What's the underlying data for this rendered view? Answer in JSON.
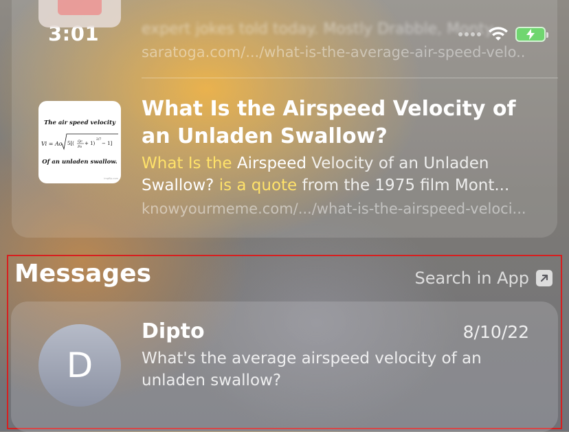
{
  "status_bar": {
    "time": "3:01",
    "battery_color": "#5dd15d"
  },
  "web_results": {
    "previous_result": {
      "snippet_blurred": "expert jokes told today. Mostly Drabble, Monty...",
      "url": "saratoga.com/.../what-is-the-average-air-speed-velo..."
    },
    "result": {
      "thumbnail_text": {
        "line1": "The air speed velocity",
        "formula_left": "Vi = Ao",
        "line3": "Of an unladen swallow.",
        "watermark": "imgflip.com"
      },
      "title": "What Is the Airspeed Velocity of an Unladen Swallow?",
      "snippet": {
        "p1": "What Is the ",
        "p2": "Airspeed",
        "p3": " Velocity of an Unladen ",
        "p4": "Swallow?",
        "p5": " is a quote",
        "p6": " from the 1975 film Mont..."
      },
      "url": "knowyourmeme.com/.../what-is-the-airspeed-veloci..."
    }
  },
  "messages": {
    "heading": "Messages",
    "search_in_app": "Search in App",
    "item": {
      "avatar_initial": "D",
      "name": "Dipto",
      "date": "8/10/22",
      "preview": "What's the average airspeed velocity of an unladen swallow?"
    }
  }
}
